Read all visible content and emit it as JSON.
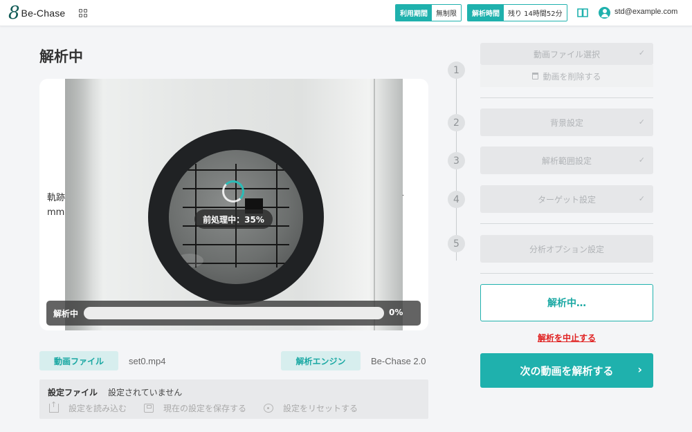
{
  "header": {
    "logo_mark": "8",
    "logo_text": "Be-Chase",
    "usage_period_label": "利用期間",
    "usage_period_value": "無制限",
    "analysis_time_label": "解析時間",
    "analysis_time_value": "残り 14時間52分",
    "user_email": "std@example.com"
  },
  "main": {
    "page_title": "解析中",
    "side_text_left_1": "軌跡",
    "side_text_left_2": "mm:",
    "side_text_right": "-",
    "preprocess_badge": "前処理中：35%",
    "preprocess_percent": 35,
    "progress_label": "解析中",
    "progress_percent_text": "0%",
    "progress_percent": 0
  },
  "files": {
    "video_file_label": "動画ファイル",
    "video_file_value": "set0.mp4",
    "engine_label": "解析エンジン",
    "engine_value": "Be-Chase 2.0"
  },
  "settings": {
    "title": "設定ファイル",
    "value": "設定されていません",
    "load_label": "設定を読み込む",
    "save_label": "現在の設定を保存する",
    "reset_label": "設定をリセットする"
  },
  "steps": {
    "items": [
      {
        "number": "1",
        "label": "動画ファイル選択",
        "check": "✓"
      },
      {
        "number": "2",
        "label": "背景設定",
        "check": "✓"
      },
      {
        "number": "3",
        "label": "解析範囲設定",
        "check": "✓"
      },
      {
        "number": "4",
        "label": "ターゲット設定",
        "check": "✓"
      },
      {
        "number": "5",
        "label": "分析オプション設定"
      }
    ],
    "delete_video_label": "動画を削除する",
    "analyzing_label": "解析中…",
    "stop_label": "解析を中止する",
    "next_label": "次の動画を解析する",
    "next_chevron": "›"
  },
  "colors": {
    "accent": "#1fb1ad",
    "danger": "#e02020"
  }
}
